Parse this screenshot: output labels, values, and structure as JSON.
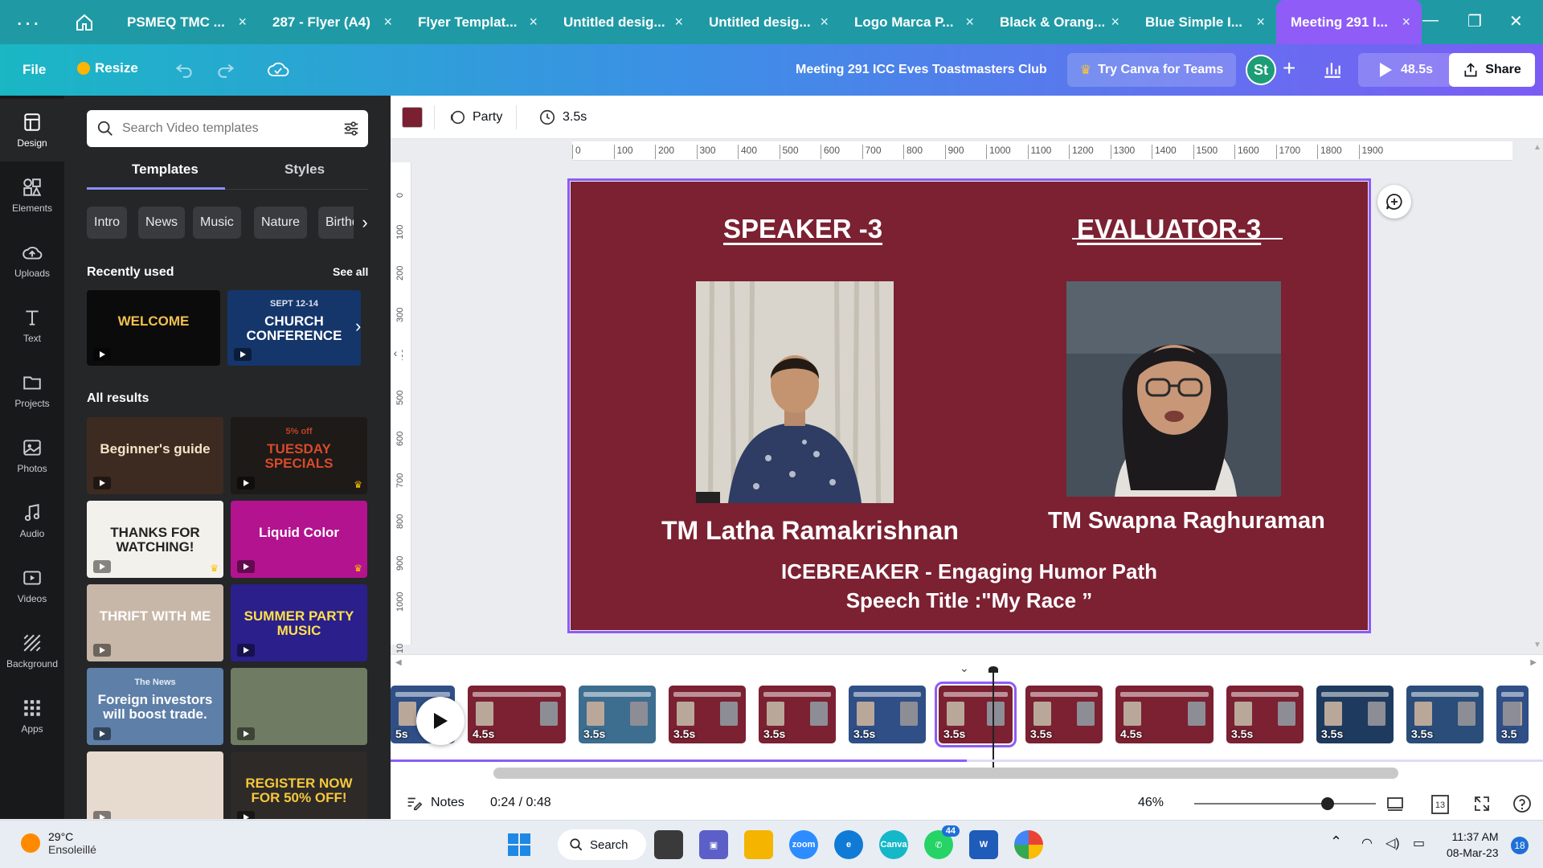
{
  "browser": {
    "tabs": [
      {
        "label": "PSMEQ TMC ...",
        "active": false
      },
      {
        "label": "287 - Flyer (A4)",
        "active": false
      },
      {
        "label": "Flyer Templat...",
        "active": false
      },
      {
        "label": "Untitled desig...",
        "active": false
      },
      {
        "label": "Untitled desig...",
        "active": false
      },
      {
        "label": "Logo Marca P...",
        "active": false
      },
      {
        "label": "Black & Orang...",
        "active": false
      },
      {
        "label": "Blue Simple I...",
        "active": false
      },
      {
        "label": "Meeting 291 I...",
        "active": true
      }
    ],
    "close_glyph": "×"
  },
  "header": {
    "file_label": "File",
    "resize_label": "Resize",
    "doc_title": "Meeting 291 ICC Eves Toastmasters Club",
    "try_teams_label": "Try Canva for Teams",
    "avatar_initials": "St",
    "present_label": "48.5s",
    "share_label": "Share"
  },
  "rail": [
    {
      "label": "Design",
      "icon": "design-icon",
      "active": true
    },
    {
      "label": "Elements",
      "icon": "elements-icon",
      "active": false
    },
    {
      "label": "Uploads",
      "icon": "cloud-upload-icon",
      "active": false
    },
    {
      "label": "Text",
      "icon": "text-icon",
      "active": false
    },
    {
      "label": "Projects",
      "icon": "folder-icon",
      "active": false
    },
    {
      "label": "Photos",
      "icon": "photo-icon",
      "active": false
    },
    {
      "label": "Audio",
      "icon": "music-note-icon",
      "active": false
    },
    {
      "label": "Videos",
      "icon": "video-icon",
      "active": false
    },
    {
      "label": "Background",
      "icon": "background-icon",
      "active": false
    },
    {
      "label": "Apps",
      "icon": "apps-grid-icon",
      "active": false
    }
  ],
  "panel": {
    "search_placeholder": "Search Video templates",
    "tabs": {
      "templates": "Templates",
      "styles": "Styles"
    },
    "chips": [
      "Intro",
      "News",
      "Music",
      "Nature",
      "Birthd"
    ],
    "recently_used_title": "Recently used",
    "see_all_label": "See all",
    "recent": [
      {
        "text": "WELCOME",
        "bg": "#0b0b0b",
        "fg": "#f2c14e"
      },
      {
        "text": "CHURCH CONFERENCE",
        "sub": "SEPT 12-14",
        "bg": "#14366b",
        "fg": "#ffffff"
      }
    ],
    "all_results_title": "All results",
    "results": [
      {
        "text": "Beginner's guide",
        "bg": "#3d2b22",
        "fg": "#f4e4c8",
        "premium": false
      },
      {
        "text": "TUESDAY SPECIALS",
        "sub": "5% off",
        "bg": "#1d1a18",
        "fg": "#d94a2a",
        "premium": true
      },
      {
        "text": "THANKS FOR WATCHING!",
        "bg": "#f3f1ec",
        "fg": "#222222",
        "premium": true
      },
      {
        "text": "Liquid Color",
        "bg": "#b3138f",
        "fg": "#ffffff",
        "premium": true
      },
      {
        "text": "THRIFT WITH ME",
        "bg": "#c7b7a8",
        "fg": "#ffffff",
        "premium": false
      },
      {
        "text": "SUMMER PARTY MUSIC",
        "bg": "#2b1f8c",
        "fg": "#ffe14a",
        "premium": false
      },
      {
        "text": "Foreign investors will boost trade.",
        "sub": "The News",
        "bg": "#5d7fa8",
        "fg": "#ffffff",
        "premium": false
      },
      {
        "text": "",
        "bg": "#6f7b62",
        "fg": "#ffffff",
        "premium": false
      },
      {
        "text": "",
        "bg": "#e7dbcf",
        "fg": "#333333",
        "premium": false
      },
      {
        "text": "REGISTER NOW FOR 50% OFF!",
        "bg": "#2d2a27",
        "fg": "#f6c73d",
        "premium": false
      }
    ]
  },
  "toolbar": {
    "color": "#7a2030",
    "animation_label": "Party",
    "duration_label": "3.5s"
  },
  "rulers": {
    "h_ticks": [
      "0",
      "100",
      "200",
      "300",
      "400",
      "500",
      "600",
      "700",
      "800",
      "900",
      "1000",
      "1100",
      "1200",
      "1300",
      "1400",
      "1500",
      "1600",
      "1700",
      "1800",
      "1900"
    ],
    "v_ticks": [
      "0",
      "100",
      "200",
      "300",
      "400",
      "500",
      "600",
      "700",
      "800",
      "900",
      "1000",
      "10"
    ]
  },
  "slide": {
    "background": "#7b2132",
    "speaker_heading": "SPEAKER -3",
    "evaluator_heading": "EVALUATOR-3",
    "speaker_name": "TM Latha Ramakrishnan",
    "evaluator_name": "TM Swapna Raghuraman",
    "line1": "ICEBREAKER  - Engaging Humor Path",
    "line2": "Speech Title  :\"My Race ”"
  },
  "timeline": {
    "frames": [
      {
        "duration": "5s",
        "color": "#2f4f86",
        "partial": true
      },
      {
        "duration": "4.5s",
        "color": "#7b2132"
      },
      {
        "duration": "3.5s",
        "color": "#3d6d8f"
      },
      {
        "duration": "3.5s",
        "color": "#7b2132"
      },
      {
        "duration": "3.5s",
        "color": "#7b2132"
      },
      {
        "duration": "3.5s",
        "color": "#2f4f86"
      },
      {
        "duration": "3.5s",
        "color": "#7b2132",
        "active": true
      },
      {
        "duration": "3.5s",
        "color": "#7b2132"
      },
      {
        "duration": "4.5s",
        "color": "#7b2132"
      },
      {
        "duration": "3.5s",
        "color": "#7b2132"
      },
      {
        "duration": "3.5s",
        "color": "#1f3a5f"
      },
      {
        "duration": "3.5s",
        "color": "#2a4d7a"
      },
      {
        "duration": "3.5",
        "color": "#2f4f86",
        "partial": true
      }
    ],
    "progress": 0.5
  },
  "footer": {
    "notes_label": "Notes",
    "timecode": "0:24 / 0:48",
    "zoom_label": "46%",
    "zoom_level": 0.46,
    "pages_count": "13"
  },
  "taskbar": {
    "temperature": "29°C",
    "weather": "Ensoleillé",
    "search_label": "Search",
    "whatsapp_badge": "44",
    "time": "11:37 AM",
    "date": "08-Mar-23",
    "notifications": "18"
  }
}
